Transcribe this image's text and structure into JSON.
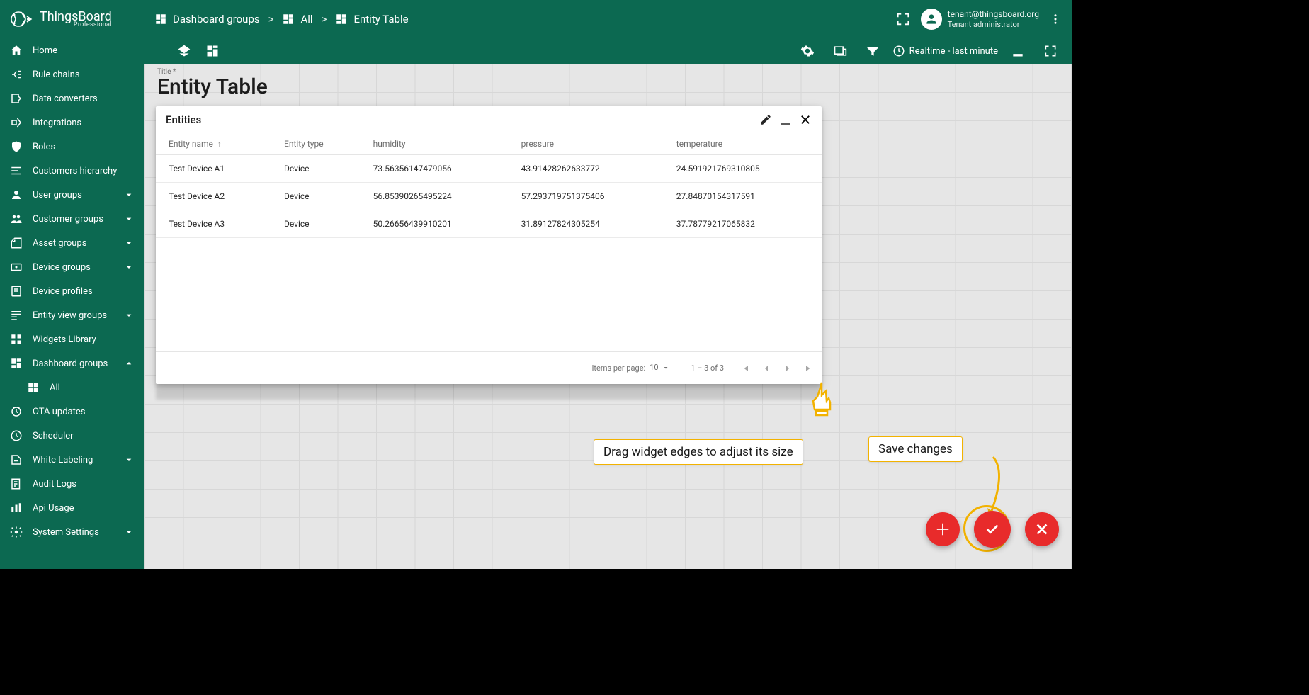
{
  "brand": {
    "name": "ThingsBoard",
    "edition": "Professional"
  },
  "sidebar": [
    {
      "icon": "home",
      "label": "Home"
    },
    {
      "icon": "rule",
      "label": "Rule chains"
    },
    {
      "icon": "converter",
      "label": "Data converters"
    },
    {
      "icon": "integration",
      "label": "Integrations"
    },
    {
      "icon": "shield",
      "label": "Roles"
    },
    {
      "icon": "hierarchy",
      "label": "Customers hierarchy"
    },
    {
      "icon": "user",
      "label": "User groups",
      "expand": "down"
    },
    {
      "icon": "customers",
      "label": "Customer groups",
      "expand": "down"
    },
    {
      "icon": "assets",
      "label": "Asset groups",
      "expand": "down"
    },
    {
      "icon": "devices",
      "label": "Device groups",
      "expand": "down"
    },
    {
      "icon": "profile",
      "label": "Device profiles"
    },
    {
      "icon": "entityview",
      "label": "Entity view groups",
      "expand": "down"
    },
    {
      "icon": "widgets",
      "label": "Widgets Library"
    },
    {
      "icon": "dashboard",
      "label": "Dashboard groups",
      "expand": "up"
    },
    {
      "icon": "dash",
      "label": "All",
      "sub": true
    },
    {
      "icon": "ota",
      "label": "OTA updates"
    },
    {
      "icon": "scheduler",
      "label": "Scheduler"
    },
    {
      "icon": "whitelabel",
      "label": "White Labeling",
      "expand": "down"
    },
    {
      "icon": "audit",
      "label": "Audit Logs"
    },
    {
      "icon": "api",
      "label": "Api Usage"
    },
    {
      "icon": "settings",
      "label": "System Settings",
      "expand": "down"
    }
  ],
  "breadcrumb": [
    {
      "icon": "dashboard",
      "label": "Dashboard groups"
    },
    {
      "icon": "dashboard",
      "label": "All"
    },
    {
      "icon": "dashboard",
      "label": "Entity Table"
    }
  ],
  "user": {
    "email": "tenant@thingsboard.org",
    "role": "Tenant administrator"
  },
  "toolbar": {
    "realtime": "Realtime - last minute"
  },
  "dashboard": {
    "titleHint": "Title *",
    "title": "Entity Table"
  },
  "widget": {
    "title": "Entities",
    "columns": [
      "Entity name",
      "Entity type",
      "humidity",
      "pressure",
      "temperature"
    ],
    "rows": [
      [
        "Test Device A1",
        "Device",
        "73.56356147479056",
        "43.91428262633772",
        "24.591921769310805"
      ],
      [
        "Test Device A2",
        "Device",
        "56.85390265495224",
        "57.293719751375406",
        "27.84870154317591"
      ],
      [
        "Test Device A3",
        "Device",
        "50.26656439910201",
        "31.89127824305254",
        "37.78779217065832"
      ]
    ],
    "pager": {
      "labelItems": "Items per page:",
      "perPage": "10",
      "range": "1 – 3 of 3"
    }
  },
  "tips": {
    "drag": "Drag widget edges to adjust its size",
    "save": "Save changes"
  },
  "colors": {
    "primary": "#0c6951",
    "accent": "#e82b2b",
    "highlight": "#f2b200"
  }
}
